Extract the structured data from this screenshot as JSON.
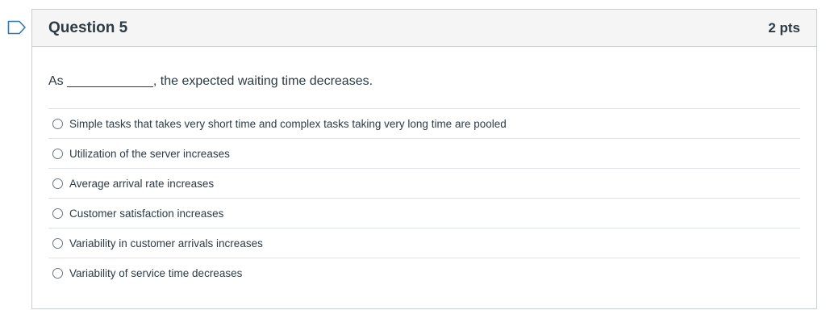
{
  "question": {
    "title": "Question 5",
    "points": "2 pts",
    "text": "As ____________, the expected waiting time decreases."
  },
  "answers": [
    {
      "label": "Simple tasks that takes very short time and complex tasks taking very long time are pooled"
    },
    {
      "label": "Utilization of the server increases"
    },
    {
      "label": "Average arrival rate increases"
    },
    {
      "label": "Customer satisfaction increases"
    },
    {
      "label": "Variability in customer arrivals increases"
    },
    {
      "label": "Variability of service time decreases"
    }
  ],
  "colors": {
    "header_bg": "#f5f5f5",
    "border": "#c7cdd1",
    "text": "#2d3b45",
    "flag": "#2b7abc"
  },
  "icons": {
    "flag": "bookmark-flag-icon"
  }
}
